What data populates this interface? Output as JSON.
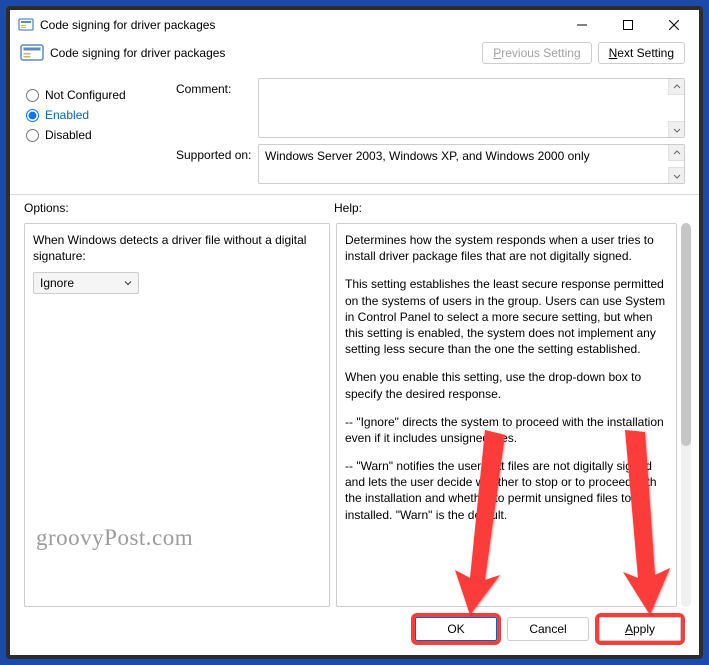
{
  "titlebar": {
    "title": "Code signing for driver packages"
  },
  "header": {
    "title": "Code signing for driver packages",
    "previous_btn": {
      "prefix": "P",
      "rest": "revious Setting"
    },
    "next_btn": {
      "prefix": "N",
      "rest": "ext Setting"
    }
  },
  "radio": {
    "not_configured": "Not Configured",
    "enabled": "Enabled",
    "disabled": "Disabled"
  },
  "fields": {
    "comment_label": "Comment:",
    "comment_value": "",
    "supported_label": "Supported on:",
    "supported_value": "Windows Server 2003, Windows XP, and Windows 2000 only"
  },
  "lower": {
    "options_label": "Options:",
    "help_label": "Help:"
  },
  "options": {
    "prompt": "When Windows detects a driver file without a digital signature:",
    "dropdown_value": "Ignore"
  },
  "help": {
    "p1": "Determines how the system responds when a user tries to install driver package files that are not digitally signed.",
    "p2": "This setting establishes the least secure response permitted on the systems of users in the group. Users can use System in Control Panel to select a more secure setting, but when this setting is enabled, the system does not implement any setting less secure than the one the setting established.",
    "p3": "When you enable this setting, use the drop-down box to specify the desired response.",
    "p4": "--   \"Ignore\" directs the system to proceed with the installation even if it includes unsigned files.",
    "p5": "--   \"Warn\" notifies the user that files are not digitally signed and lets the user decide whether to stop or to proceed with the installation and whether to permit unsigned files to be installed. \"Warn\" is the default."
  },
  "footer": {
    "ok": "OK",
    "cancel": "Cancel",
    "apply_prefix": "A",
    "apply_rest": "pply"
  },
  "watermark": "groovyPost.com"
}
